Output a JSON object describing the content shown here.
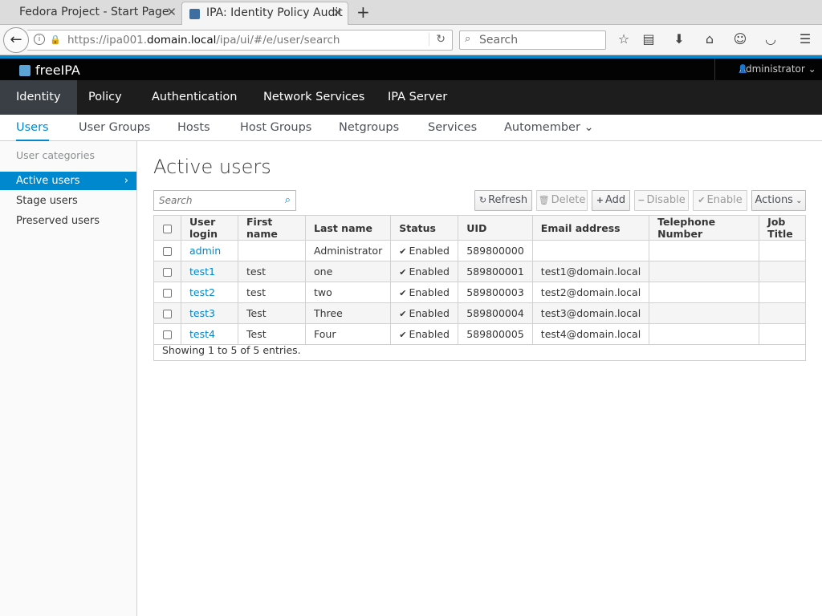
{
  "browser": {
    "tabs": [
      {
        "title": "Fedora Project - Start Page"
      },
      {
        "title": "IPA: Identity Policy Audit"
      }
    ],
    "url_prefix": "https://ipa001.",
    "url_domain": "domain.local",
    "url_path": "/ipa/ui/#/e/user/search",
    "search_placeholder": "Search"
  },
  "app": {
    "brand": "freeIPA",
    "user_menu": "Administrator"
  },
  "primary_nav": [
    "Identity",
    "Policy",
    "Authentication",
    "Network Services",
    "IPA Server"
  ],
  "secondary_nav": [
    "Users",
    "User Groups",
    "Hosts",
    "Host Groups",
    "Netgroups",
    "Services",
    "Automember"
  ],
  "sidebar": {
    "title": "User categories",
    "items": [
      "Active users",
      "Stage users",
      "Preserved users"
    ]
  },
  "main": {
    "title": "Active users",
    "filter_placeholder": "Search",
    "buttons": {
      "refresh": "Refresh",
      "delete": "Delete",
      "add": "Add",
      "disable": "Disable",
      "enable": "Enable",
      "actions": "Actions"
    },
    "columns": [
      "User login",
      "First name",
      "Last name",
      "Status",
      "UID",
      "Email address",
      "Telephone Number",
      "Job Title"
    ],
    "rows": [
      {
        "login": "admin",
        "first": "",
        "last": "Administrator",
        "status": "Enabled",
        "uid": "589800000",
        "email": "",
        "phone": "",
        "job": ""
      },
      {
        "login": "test1",
        "first": "test",
        "last": "one",
        "status": "Enabled",
        "uid": "589800001",
        "email": "test1@domain.local",
        "phone": "",
        "job": ""
      },
      {
        "login": "test2",
        "first": "test",
        "last": "two",
        "status": "Enabled",
        "uid": "589800003",
        "email": "test2@domain.local",
        "phone": "",
        "job": ""
      },
      {
        "login": "test3",
        "first": "Test",
        "last": "Three",
        "status": "Enabled",
        "uid": "589800004",
        "email": "test3@domain.local",
        "phone": "",
        "job": ""
      },
      {
        "login": "test4",
        "first": "Test",
        "last": "Four",
        "status": "Enabled",
        "uid": "589800005",
        "email": "test4@domain.local",
        "phone": "",
        "job": ""
      }
    ],
    "footer": "Showing 1 to 5 of 5 entries."
  },
  "colors": {
    "accent": "#0088ce",
    "header_bg": "#030303",
    "primary_nav_bg": "#1d1d1d",
    "primary_nav_active": "#393f44"
  }
}
